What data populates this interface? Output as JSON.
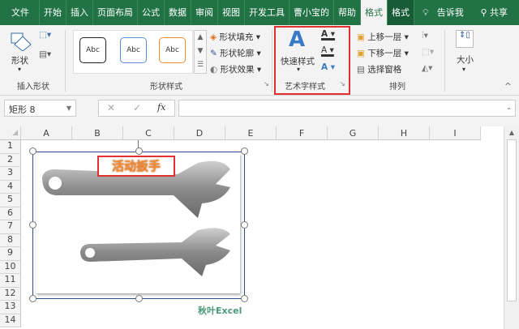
{
  "tabs": [
    "文件",
    "开始",
    "插入",
    "页面布局",
    "公式",
    "数据",
    "审阅",
    "视图",
    "开发工具",
    "曹小宝的",
    "帮助",
    "格式",
    "格式",
    "告诉我",
    "共享"
  ],
  "ribbon": {
    "insert_shape": {
      "shape": "形状",
      "label": "插入形状"
    },
    "shape_styles": {
      "samples": [
        "Abc",
        "Abc",
        "Abc"
      ],
      "fill": "形状填充",
      "outline": "形状轮廓",
      "effect": "形状效果",
      "label": "形状样式"
    },
    "wordart": {
      "quick": "快速样式",
      "label": "艺术字样式"
    },
    "arrange": {
      "forward": "上移一层",
      "backward": "下移一层",
      "pane": "选择窗格",
      "label": "排列"
    },
    "size": {
      "label": "大小"
    }
  },
  "formula_bar": {
    "name_box": "矩形 8",
    "fx": "fx",
    "value": ""
  },
  "columns": [
    "A",
    "B",
    "C",
    "D",
    "E",
    "F",
    "G",
    "H",
    "I"
  ],
  "rows": [
    "1",
    "2",
    "3",
    "4",
    "5",
    "6",
    "7",
    "8",
    "9",
    "10",
    "11",
    "12",
    "13",
    "14"
  ],
  "picture": {
    "title": "活动扳手",
    "watermark": "秋叶Excel"
  },
  "colors": {
    "accent": "#217346",
    "highlight": "#e03030",
    "title": "#f08a30"
  }
}
